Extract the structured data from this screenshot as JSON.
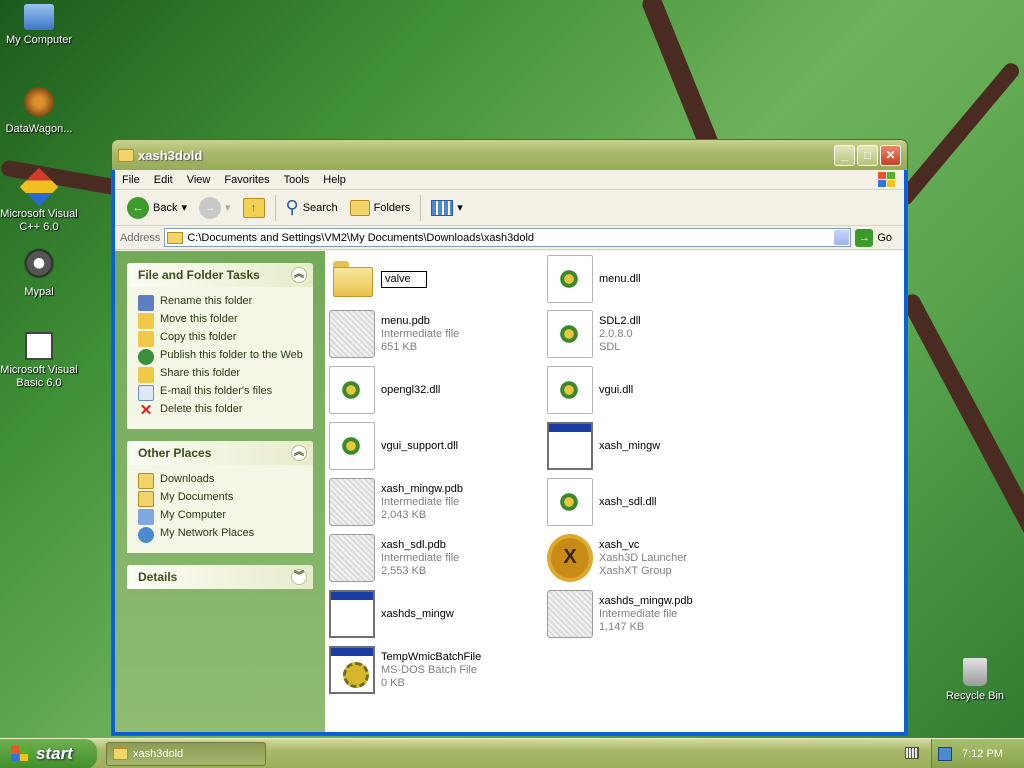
{
  "desktop": {
    "icons": [
      {
        "label": "My Computer",
        "icon": "my-computer-icon"
      },
      {
        "label": "DataWagon...",
        "icon": "datawagon-shortcut-icon"
      },
      {
        "label": "Microsoft Visual C++ 6.0",
        "icon": "visual-cpp-icon"
      },
      {
        "label": "Mypal",
        "icon": "mypal-icon"
      },
      {
        "label": "Microsoft Visual Basic 6.0",
        "icon": "visual-basic-icon"
      },
      {
        "label": "Recycle Bin",
        "icon": "recycle-bin-icon"
      }
    ]
  },
  "window": {
    "title": "xash3dold",
    "controls": {
      "minimize": "_",
      "maximize": "□",
      "close": "✕"
    },
    "menu": [
      "File",
      "Edit",
      "View",
      "Favorites",
      "Tools",
      "Help"
    ],
    "toolbar": {
      "back": "Back",
      "search": "Search",
      "folders": "Folders"
    },
    "address": {
      "label": "Address",
      "value": "C:\\Documents and Settings\\VM2\\My Documents\\Downloads\\xash3dold",
      "go": "Go"
    }
  },
  "tasks": {
    "file_folder": {
      "title": "File and Folder Tasks",
      "items": [
        {
          "label": "Rename this folder",
          "icon": "rename-icon"
        },
        {
          "label": "Move this folder",
          "icon": "move-icon"
        },
        {
          "label": "Copy this folder",
          "icon": "copy-icon"
        },
        {
          "label": "Publish this folder to the Web",
          "icon": "publish-web-icon"
        },
        {
          "label": "Share this folder",
          "icon": "share-icon"
        },
        {
          "label": "E-mail this folder's files",
          "icon": "email-icon"
        },
        {
          "label": "Delete this folder",
          "icon": "delete-icon"
        }
      ]
    },
    "other_places": {
      "title": "Other Places",
      "items": [
        {
          "label": "Downloads",
          "icon": "folder-icon"
        },
        {
          "label": "My Documents",
          "icon": "my-documents-icon"
        },
        {
          "label": "My Computer",
          "icon": "my-computer-icon"
        },
        {
          "label": "My Network Places",
          "icon": "network-places-icon"
        }
      ]
    },
    "details": {
      "title": "Details"
    }
  },
  "files": [
    {
      "name": "valve",
      "type": "folder",
      "line2": "",
      "line3": "",
      "renaming": true
    },
    {
      "name": "menu.dll",
      "type": "dll",
      "line2": "",
      "line3": ""
    },
    {
      "name": "menu.pdb",
      "type": "pdb",
      "line2": "Intermediate file",
      "line3": "651 KB"
    },
    {
      "name": "SDL2.dll",
      "type": "dll",
      "line2": "2.0.8.0",
      "line3": "SDL"
    },
    {
      "name": "opengl32.dll",
      "type": "dll",
      "line2": "",
      "line3": ""
    },
    {
      "name": "vgui.dll",
      "type": "dll",
      "line2": "",
      "line3": ""
    },
    {
      "name": "vgui_support.dll",
      "type": "dll",
      "line2": "",
      "line3": ""
    },
    {
      "name": "xash_mingw",
      "type": "app",
      "line2": "",
      "line3": ""
    },
    {
      "name": "xash_mingw.pdb",
      "type": "pdb",
      "line2": "Intermediate file",
      "line3": "2,043 KB"
    },
    {
      "name": "xash_sdl.dll",
      "type": "dll",
      "line2": "",
      "line3": ""
    },
    {
      "name": "xash_sdl.pdb",
      "type": "pdb",
      "line2": "Intermediate file",
      "line3": "2,553 KB"
    },
    {
      "name": "xash_vc",
      "type": "xvc",
      "line2": "Xash3D Launcher",
      "line3": "XashXT Group"
    },
    {
      "name": "xashds_mingw",
      "type": "app",
      "line2": "",
      "line3": ""
    },
    {
      "name": "xashds_mingw.pdb",
      "type": "pdb",
      "line2": "Intermediate file",
      "line3": "1,147 KB"
    },
    {
      "name": "TempWmicBatchFile",
      "type": "bat",
      "line2": "MS-DOS Batch File",
      "line3": "0 KB"
    }
  ],
  "taskbar": {
    "start": "start",
    "task": "xash3dold",
    "clock": "7:12 PM"
  }
}
